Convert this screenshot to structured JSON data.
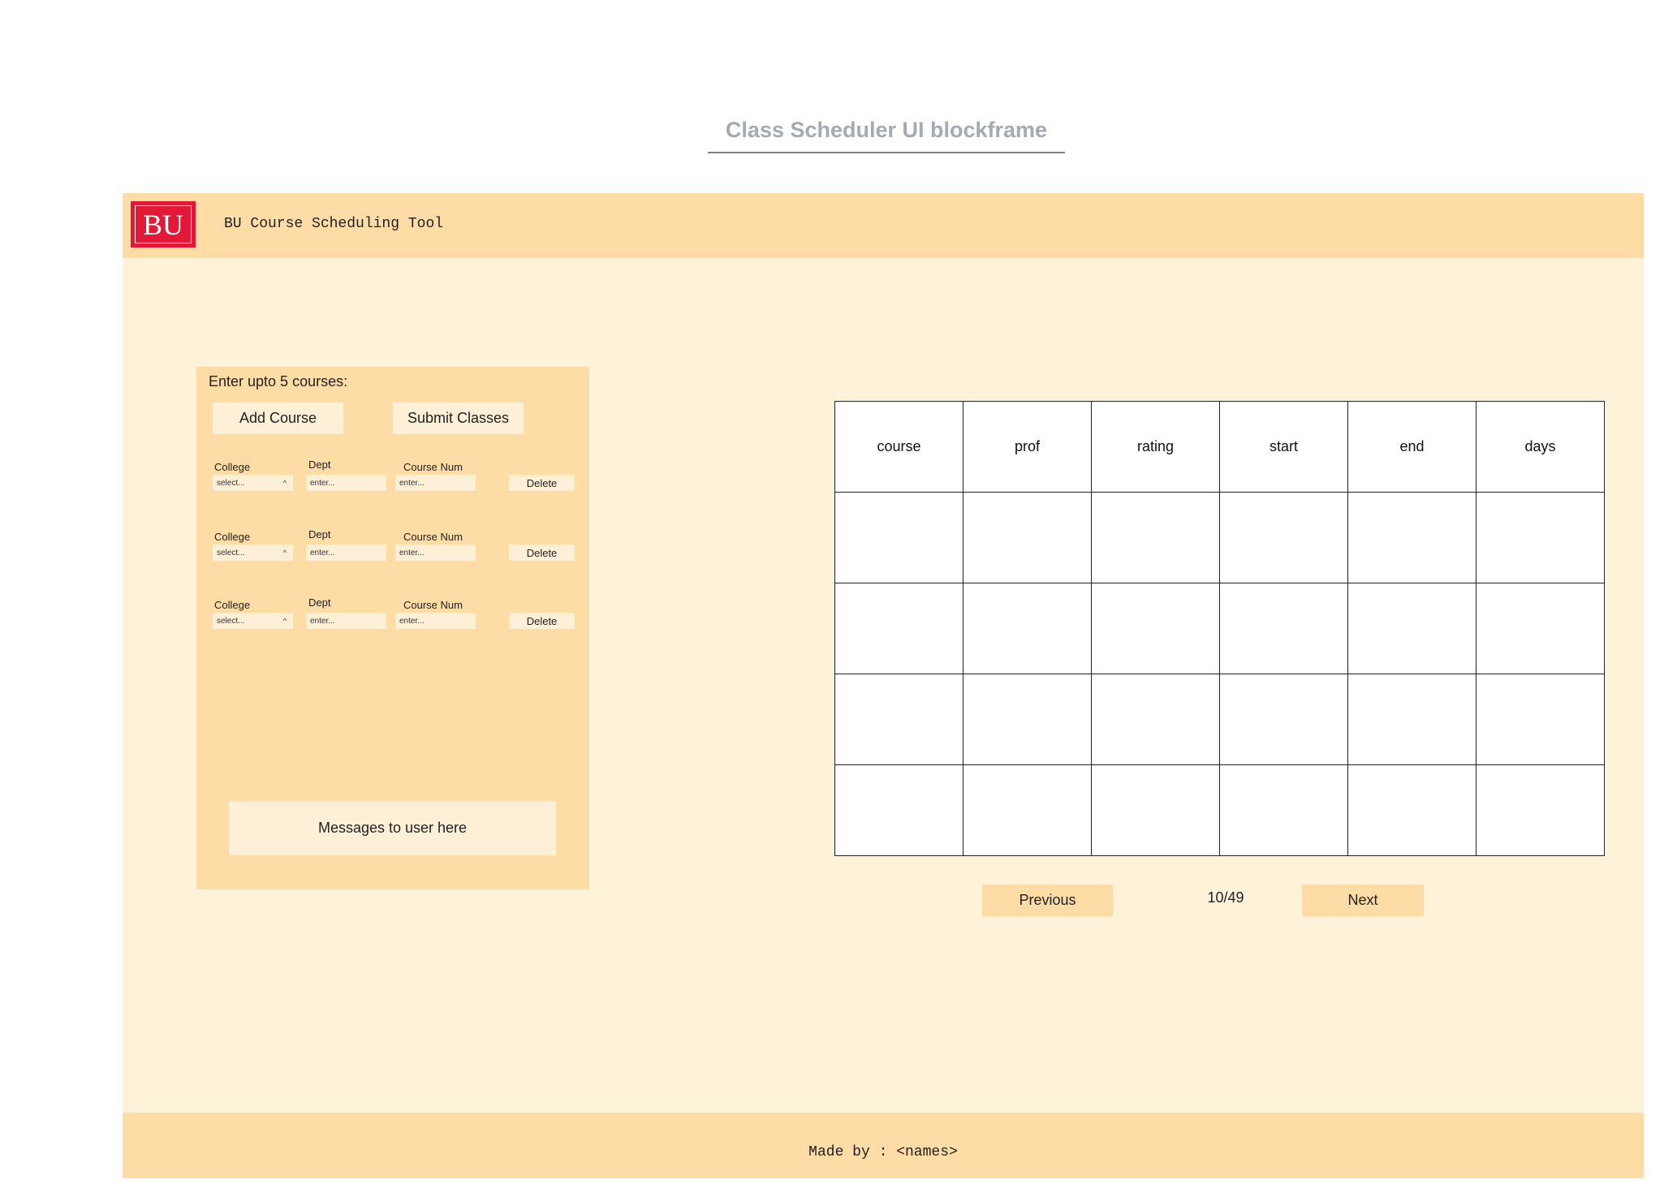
{
  "blockframe_title": "Class Scheduler UI blockframe",
  "header": {
    "logo_text": "BU",
    "app_title": "BU Course Scheduling Tool",
    "logo_color": "#e21836"
  },
  "course_panel": {
    "heading": "Enter upto 5 courses:",
    "add_course_label": "Add Course",
    "submit_label": "Submit Classes",
    "rows": [
      {
        "college_label": "College",
        "college_value": "select...",
        "caret": "^",
        "dept_label": "Dept",
        "dept_placeholder": "enter...",
        "num_label": "Course Num",
        "num_placeholder": "enter...",
        "delete_label": "Delete"
      },
      {
        "college_label": "College",
        "college_value": "select...",
        "caret": "^",
        "dept_label": "Dept",
        "dept_placeholder": "enter...",
        "num_label": "Course Num",
        "num_placeholder": "enter...",
        "delete_label": "Delete"
      },
      {
        "college_label": "College",
        "college_value": "select...",
        "caret": "^",
        "dept_label": "Dept",
        "dept_placeholder": "enter...",
        "num_label": "Course Num",
        "num_placeholder": "enter...",
        "delete_label": "Delete"
      }
    ],
    "message": "Messages to user here"
  },
  "results": {
    "columns": [
      "course",
      "prof",
      "rating",
      "start",
      "end",
      "days"
    ],
    "rows": [
      [
        "",
        "",
        "",
        "",
        "",
        ""
      ],
      [
        "",
        "",
        "",
        "",
        "",
        ""
      ],
      [
        "",
        "",
        "",
        "",
        "",
        ""
      ],
      [
        "",
        "",
        "",
        "",
        "",
        ""
      ]
    ]
  },
  "pagination": {
    "prev_label": "Previous",
    "page_indicator": "10/49",
    "next_label": "Next"
  },
  "footer": {
    "text": "Made by : <names>"
  },
  "colors": {
    "header_bg": "#fddca6",
    "page_bg": "#fef2d8",
    "input_bg": "#fef0d6"
  }
}
